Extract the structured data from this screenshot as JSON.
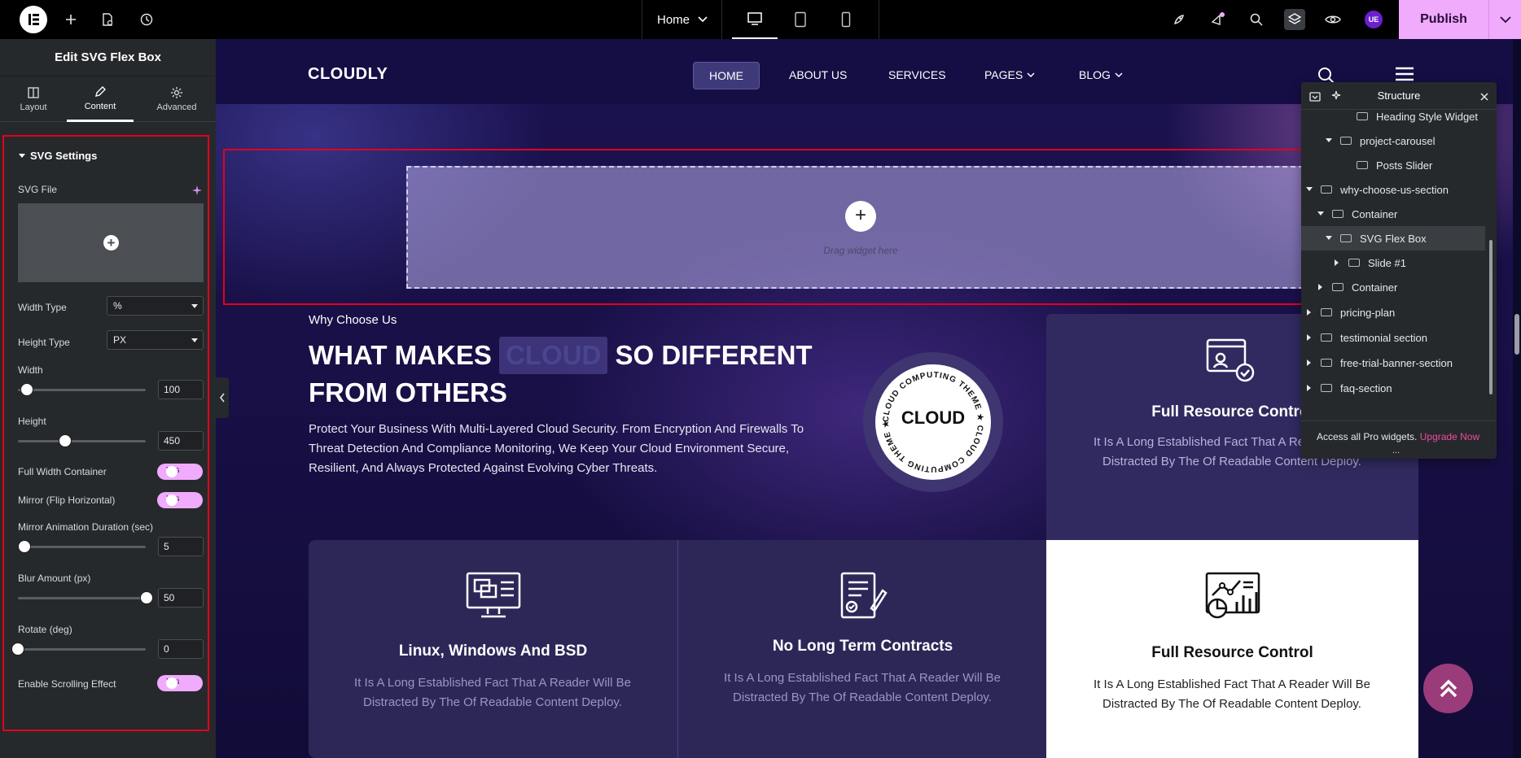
{
  "topbar": {
    "page_label": "Home",
    "publish_label": "Publish",
    "avatar_initials": "UE"
  },
  "panel": {
    "title": "Edit SVG Flex Box",
    "tabs": [
      {
        "label": "Layout",
        "icon": "layout-icon"
      },
      {
        "label": "Content",
        "icon": "pencil-icon"
      },
      {
        "label": "Advanced",
        "icon": "gear-icon"
      }
    ],
    "section_title": "SVG Settings",
    "svg_file_label": "SVG File",
    "width_type_label": "Width Type",
    "width_type_value": "%",
    "height_type_label": "Height Type",
    "height_type_value": "PX",
    "width_label": "Width",
    "width_value": "100",
    "height_label": "Height",
    "height_value": "450",
    "full_width_label": "Full Width Container",
    "mirror_label": "Mirror (Flip Horizontal)",
    "mirror_duration_label": "Mirror Animation Duration (sec)",
    "mirror_duration_value": "5",
    "blur_label": "Blur Amount (px)",
    "blur_value": "50",
    "rotate_label": "Rotate (deg)",
    "rotate_value": "0",
    "scrolling_label": "Enable Scrolling Effect",
    "toggle_yes": "Yes"
  },
  "site": {
    "brand": "CLOUDLY",
    "nav": [
      {
        "label": "HOME"
      },
      {
        "label": "ABOUT US"
      },
      {
        "label": "SERVICES"
      },
      {
        "label": "PAGES"
      },
      {
        "label": "BLOG"
      }
    ],
    "drag_text": "Drag widget here",
    "why_subtitle": "Why Choose Us",
    "why_title_part1": "WHAT MAKES",
    "why_title_highlight": "CLOUD",
    "why_title_part2": "SO DIFFERENT FROM OTHERS",
    "why_desc": "Protect Your Business With Multi-Layered Cloud Security. From Encryption And Firewalls To Threat Detection And Compliance Monitoring, We Keep Your Cloud Environment Secure, Resilient, And Always Protected Against Evolving Cyber Threats.",
    "badge_text": "CLOUD",
    "badge_ring_text": "CLOUD COMPUTING THEME ★ CLOUD COMPUTING THEME ★",
    "feature_top": {
      "title": "Full Resource Control",
      "desc": "It Is A Long Established Fact That A Reader Will Be Distracted By The Of Readable Content Deploy."
    },
    "cards": [
      {
        "title": "Linux, Windows And BSD",
        "desc": "It Is A Long Established Fact That A Reader Will Be Distracted By The Of Readable Content Deploy.",
        "icon": "computer-icon"
      },
      {
        "title": "No Long Term Contracts",
        "desc": "It Is A Long Established Fact That A Reader Will Be Distracted By The Of Readable Content Deploy.",
        "icon": "contract-icon"
      },
      {
        "title": "Full Resource Control",
        "desc": "It Is A Long Established Fact That A Reader Will Be Distracted By The Of Readable Content Deploy.",
        "icon": "analytics-icon"
      }
    ]
  },
  "structure": {
    "title": "Structure",
    "rows": [
      {
        "label": "Heading Style Widget",
        "arrow": "",
        "icon": "heading-icon"
      },
      {
        "label": "project-carousel",
        "arrow": "down",
        "icon": "container-icon"
      },
      {
        "label": "Posts Slider",
        "arrow": "",
        "icon": "slider-icon"
      },
      {
        "label": "why-choose-us-section",
        "arrow": "down",
        "icon": "container-icon"
      },
      {
        "label": "Container",
        "arrow": "down",
        "icon": "container-icon"
      },
      {
        "label": "SVG Flex Box",
        "arrow": "down",
        "icon": "container-icon"
      },
      {
        "label": "Slide #1",
        "arrow": "right",
        "icon": "container-icon"
      },
      {
        "label": "Container",
        "arrow": "right",
        "icon": "container-icon"
      },
      {
        "label": "pricing-plan",
        "arrow": "right",
        "icon": "container-icon"
      },
      {
        "label": "testimonial section",
        "arrow": "right",
        "icon": "container-icon"
      },
      {
        "label": "free-trial-banner-section",
        "arrow": "right",
        "icon": "container-icon"
      },
      {
        "label": "faq-section",
        "arrow": "right",
        "icon": "container-icon"
      }
    ],
    "footer_text": "Access all Pro widgets.",
    "footer_link": "Upgrade Now",
    "dots": "..."
  },
  "colors": {
    "accent_pink": "#f0abfc",
    "selection_red": "#e4001b",
    "panel_bg": "#26292c",
    "site_bg": "#1a1250"
  }
}
